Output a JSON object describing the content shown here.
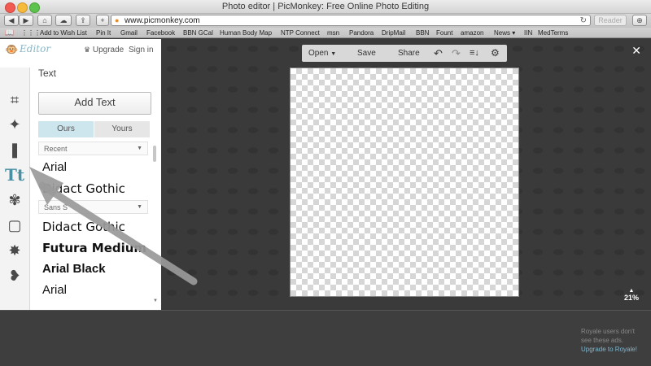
{
  "window": {
    "title": "Photo editor | PicMonkey: Free Online Photo Editing"
  },
  "browser": {
    "url": "www.picmonkey.com",
    "reader_label": "Reader",
    "bookmarks": [
      "Add to Wish List",
      "Pin It",
      "Gmail",
      "Facebook",
      "BBN GCal",
      "Human Body Map",
      "NTP Connect",
      "msn",
      "Pandora",
      "DripMail",
      "BBN",
      "Fount",
      "amazon",
      "News ▾",
      "IIN",
      "MedTerms"
    ]
  },
  "app": {
    "logo": "Editor",
    "upgrade_label": "Upgrade",
    "signin_label": "Sign in",
    "menu": {
      "open": "Open",
      "save": "Save",
      "share": "Share"
    },
    "zoom": "21%"
  },
  "text_panel": {
    "title": "Text",
    "add_text_label": "Add Text",
    "tabs": [
      "Ours",
      "Yours"
    ],
    "recent_label": "Recent",
    "sans_label": "Sans S",
    "fonts": [
      "Arial",
      "Didact Gothic",
      "Didact Gothic",
      "Futura Medium",
      "Arial Black",
      "Arial"
    ]
  },
  "ad": {
    "note": "Royale users don't see these ads.",
    "link": "Upgrade to Royale!"
  },
  "tools": [
    "crop-icon",
    "magic-wand-icon",
    "lipstick-icon",
    "text-icon",
    "butterfly-icon",
    "frame-icon",
    "texture-icon",
    "heart-icon"
  ]
}
